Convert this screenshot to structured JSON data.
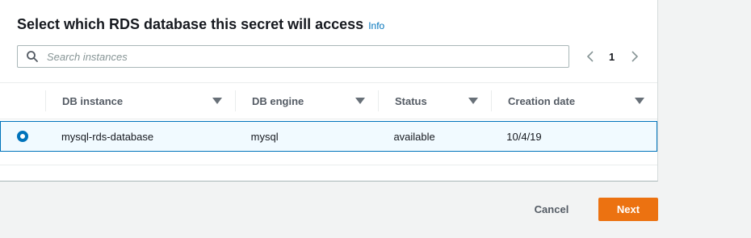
{
  "header": {
    "title": "Select which RDS database this secret will access",
    "info_link": "Info"
  },
  "search": {
    "placeholder": "Search instances",
    "value": ""
  },
  "pagination": {
    "current_page": "1"
  },
  "table": {
    "columns": [
      "DB instance",
      "DB engine",
      "Status",
      "Creation date"
    ],
    "rows": [
      {
        "selected": true,
        "db_instance": "mysql-rds-database",
        "db_engine": "mysql",
        "status": "available",
        "creation_date": "10/4/19"
      }
    ]
  },
  "footer": {
    "cancel_label": "Cancel",
    "next_label": "Next"
  },
  "colors": {
    "accent": "#0073bb",
    "primary_button": "#ec7211",
    "selected_row_bg": "#f1faff"
  },
  "icons": {
    "search": "search-icon",
    "prev": "chevron-left-icon",
    "next": "chevron-right-icon",
    "sort": "caret-down-icon"
  }
}
